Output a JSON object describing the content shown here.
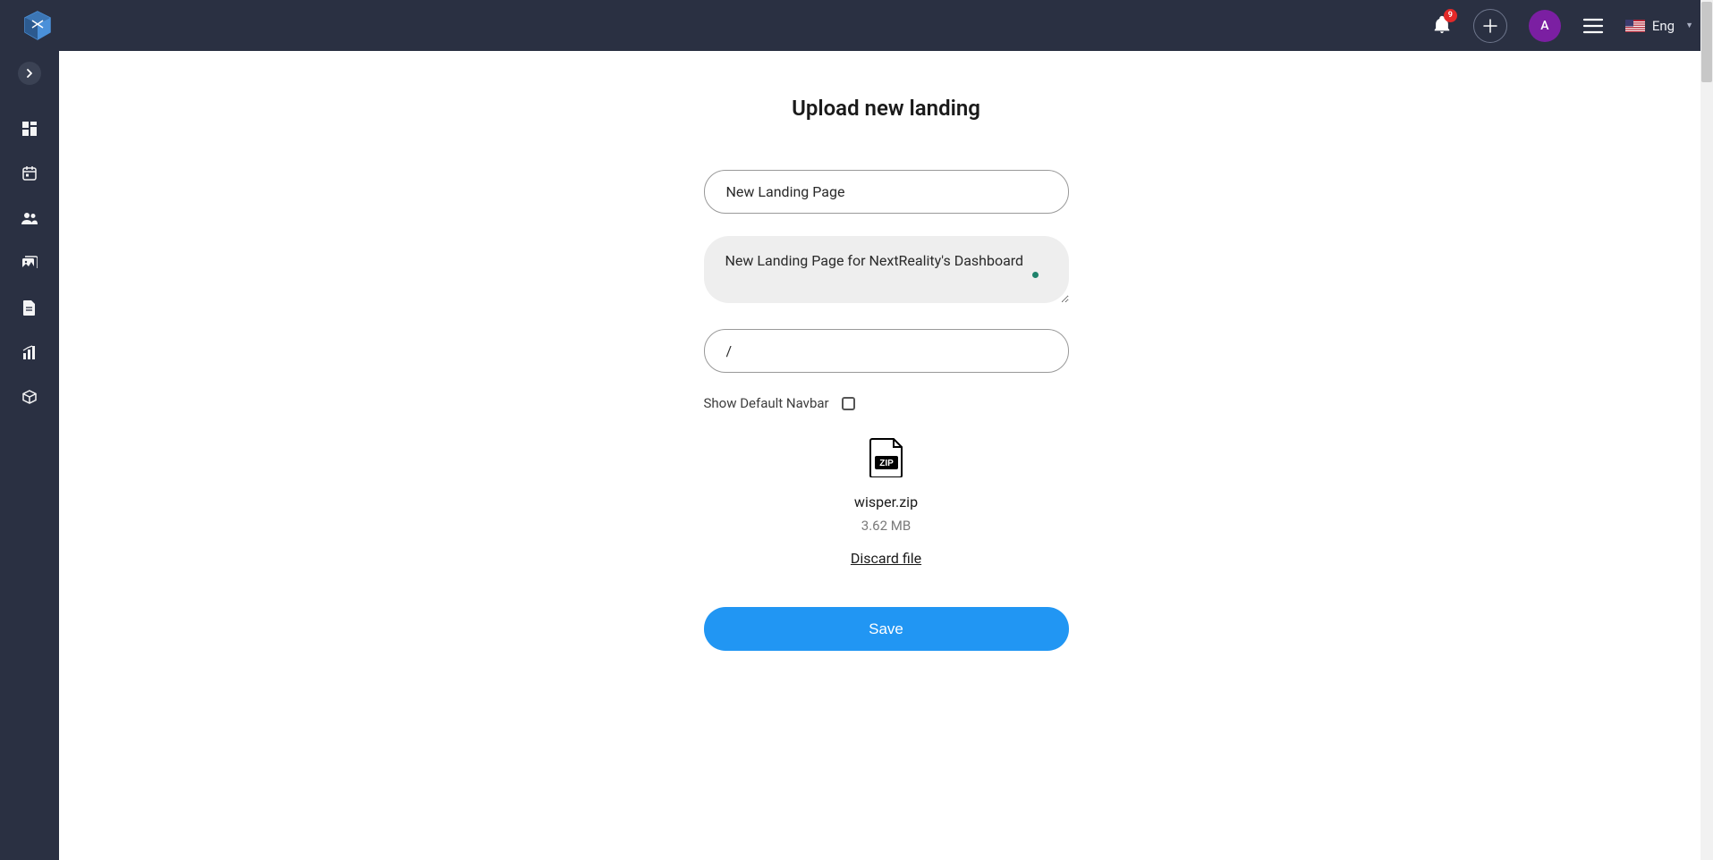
{
  "header": {
    "notif_count": "9",
    "avatar_letter": "A",
    "lang_label": "Eng"
  },
  "page": {
    "title": "Upload new landing"
  },
  "form": {
    "name_value": "New Landing Page",
    "description_value": "New Landing Page for NextReality's Dashboard",
    "path_value": "/",
    "navbar_label": "Show Default Navbar",
    "save_label": "Save"
  },
  "file": {
    "name": "wisper.zip",
    "size": "3.62 MB",
    "discard_label": "Discard file"
  }
}
